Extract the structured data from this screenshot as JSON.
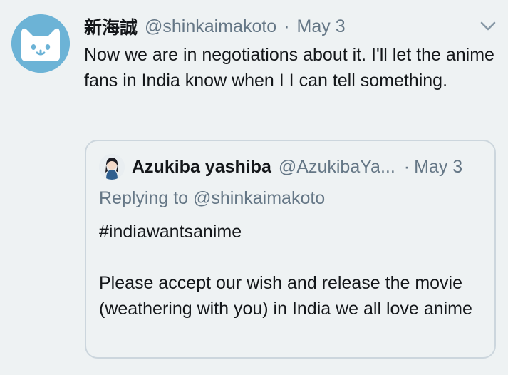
{
  "tweet": {
    "avatar_icon": "cat-face-icon",
    "display_name": "新海誠",
    "handle": "@shinkaimakoto",
    "separator": "·",
    "date": "May 3",
    "menu_icon": "chevron-down-icon",
    "text": "Now we are in negotiations about it. I'll let the anime fans in India know when I I can tell something."
  },
  "quoted_tweet": {
    "avatar_icon": "user-avatar-icon",
    "display_name": "Azukiba yashiba",
    "handle": "@AzukibaYa...",
    "separator": "·",
    "date": "May 3",
    "replying_to": "Replying to @shinkaimakoto",
    "hashtag": "#indiawantsanime",
    "text": "Please accept our wish and release the movie (weathering with you) in India we all love anime"
  },
  "colors": {
    "background": "#eef2f3",
    "text_primary": "#14171a",
    "text_secondary": "#657786",
    "border": "#ccd6dd",
    "avatar_blue": "#6cb3d6"
  }
}
